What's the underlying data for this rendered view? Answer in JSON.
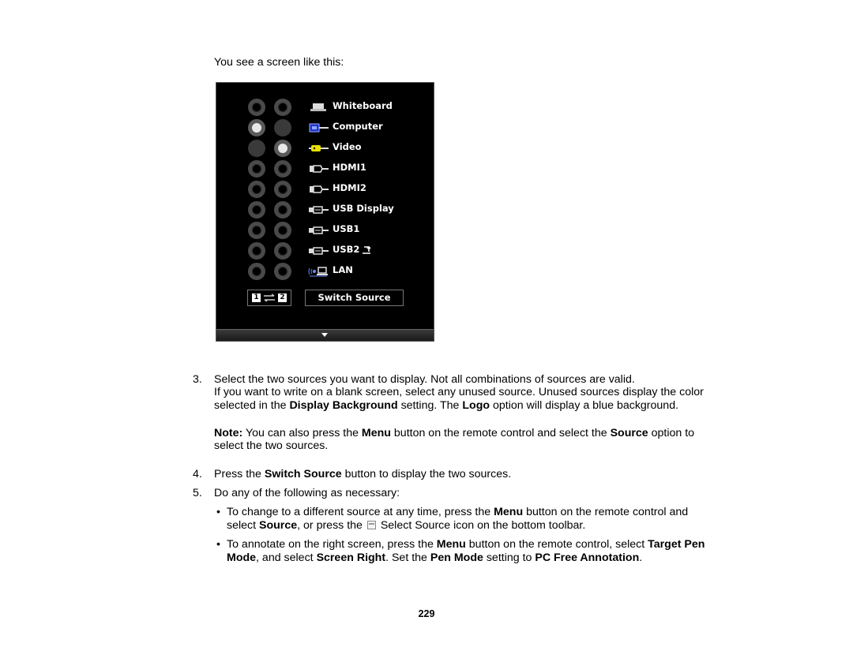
{
  "intro": "You see a screen like this:",
  "screen": {
    "sources": [
      {
        "label": "Whiteboard",
        "icon": "whiteboard-icon",
        "left": "ring",
        "right": "ring"
      },
      {
        "label": "Computer",
        "icon": "computer-vga-icon",
        "left": "selected",
        "right": "filled"
      },
      {
        "label": "Video",
        "icon": "video-rca-icon",
        "left": "filled",
        "right": "selected"
      },
      {
        "label": "HDMI1",
        "icon": "hdmi-icon",
        "left": "ring",
        "right": "ring"
      },
      {
        "label": "HDMI2",
        "icon": "hdmi-icon",
        "left": "ring",
        "right": "ring"
      },
      {
        "label": "USB Display",
        "icon": "usb-icon",
        "left": "ring",
        "right": "ring"
      },
      {
        "label": "USB1",
        "icon": "usb-icon",
        "left": "ring",
        "right": "ring"
      },
      {
        "label": "USB2",
        "icon": "usb-icon",
        "left": "ring",
        "right": "ring"
      },
      {
        "label": "LAN",
        "icon": "lan-icon",
        "left": "ring",
        "right": "ring"
      }
    ],
    "swap_left": "1",
    "swap_right": "2",
    "switch_source": "Switch Source",
    "colors": {
      "computer_icon": "#2233cc",
      "video_icon": "#e8e000"
    }
  },
  "steps": {
    "s3": {
      "num": "3.",
      "line1": "Select the two sources you want to display. Not all combinations of sources are valid.",
      "line2": "If you want to write on a blank screen, select any unused source. Unused sources display the color",
      "line3a": "selected in the ",
      "line3b": "Display Background",
      "line3c": " setting. The ",
      "line3d": "Logo",
      "line3e": " option will display a blue background."
    },
    "note": {
      "a": "Note:",
      "b": " You can also press the ",
      "c": "Menu",
      "d": " button on the remote control and select the ",
      "e": "Source",
      "f": " option to",
      "line2": "select the two sources."
    },
    "s4": {
      "num": "4.",
      "a": "Press the ",
      "b": "Switch Source",
      "c": " button to display the two sources."
    },
    "s5": {
      "num": "5.",
      "text": "Do any of the following as necessary:"
    },
    "b1": {
      "a": "To change to a different source at any time, press the ",
      "b": "Menu",
      "c": " button on the remote control and",
      "d": "select ",
      "e": "Source",
      "f": ", or press the",
      "g": " Select Source icon on the bottom toolbar."
    },
    "b2": {
      "a": "To annotate on the right screen, press the ",
      "b": "Menu",
      "c": " button on the remote control, select ",
      "d": "Target Pen",
      "e": "Mode",
      "f": ", and select ",
      "g": "Screen Right",
      "h": ". Set the ",
      "i": "Pen Mode",
      "j": " setting to ",
      "k": "PC Free Annotation",
      "l": "."
    },
    "bullet_char": "•"
  },
  "page_number": "229"
}
